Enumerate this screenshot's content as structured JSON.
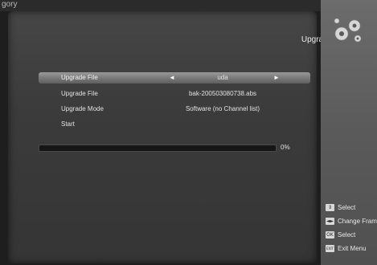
{
  "window": {
    "top_label": "gory"
  },
  "header": {
    "title": "Upgrade By USB"
  },
  "menu": {
    "rows": [
      {
        "label": "Upgrade File",
        "value": "uda",
        "selected": true
      },
      {
        "label": "Upgrade File",
        "value": "bak-200503080738.abs"
      },
      {
        "label": "Upgrade Mode",
        "value": "Software (no Channel list)"
      },
      {
        "label": "Start",
        "value": ""
      }
    ],
    "arrow_left": "◄",
    "arrow_right": "►"
  },
  "progress": {
    "percent_label": "0%",
    "fraction": 0
  },
  "legend": {
    "items": [
      {
        "key": "⇕",
        "text": "Select",
        "icon": "up-down-keys-icon"
      },
      {
        "key": "◄►",
        "text": "Change Fram",
        "icon": "left-right-keys-icon"
      },
      {
        "key": "OK",
        "text": "Select",
        "icon": "ok-key-icon"
      },
      {
        "key": "EXIT",
        "text": "Exit Menu",
        "icon": "exit-key-icon"
      }
    ]
  },
  "colors": {
    "panel": "#3b3b3b",
    "side_panel": "#5a5a5a",
    "highlight": "#8a8a8a",
    "text": "#e2e2e2"
  }
}
